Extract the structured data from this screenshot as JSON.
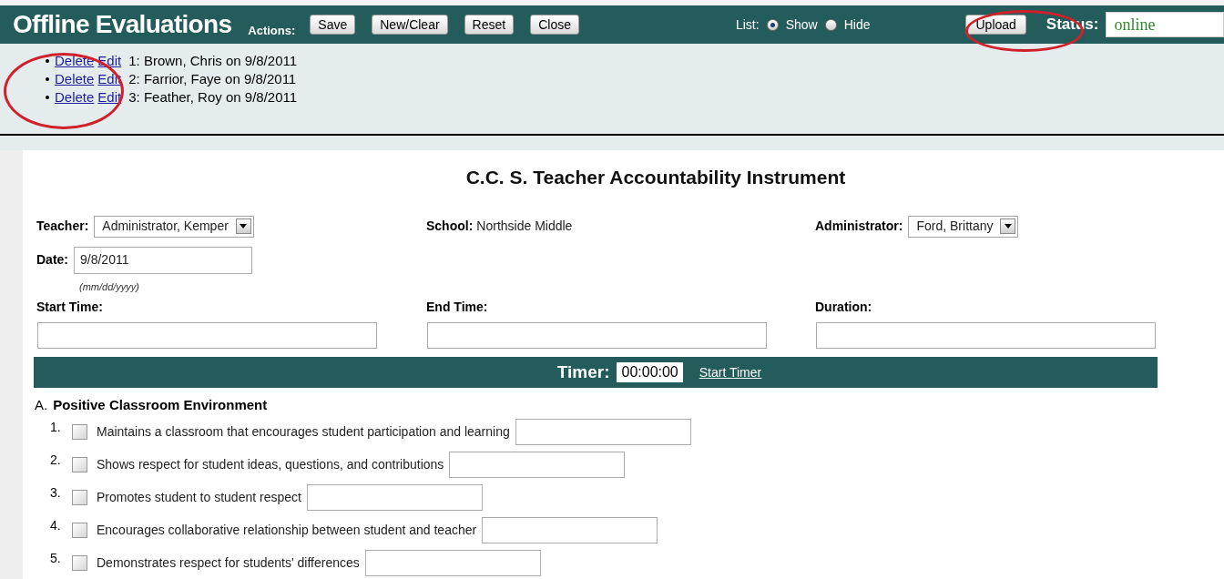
{
  "header": {
    "title": "Offline Evaluations",
    "actions_label": "Actions:",
    "buttons": [
      "Save",
      "New/Clear",
      "Reset",
      "Close"
    ],
    "list_toggle": {
      "label": "List:",
      "options": [
        {
          "label": "Show",
          "selected": true
        },
        {
          "label": "Hide",
          "selected": false
        }
      ]
    },
    "upload_button": "Upload",
    "status_label": "Status:",
    "status_value": "online"
  },
  "saved_list": [
    {
      "delete": "Delete",
      "edit": "Edit",
      "text": "1: Brown, Chris on 9/8/2011"
    },
    {
      "delete": "Delete",
      "edit": "Edit",
      "text": "2: Farrior, Faye on 9/8/2011"
    },
    {
      "delete": "Delete",
      "edit": "Edit",
      "text": "3: Feather, Roy on 9/8/2011"
    }
  ],
  "form": {
    "title": "C.C. S. Teacher Accountability Instrument",
    "teacher": {
      "label": "Teacher:",
      "value": "Administrator, Kemper"
    },
    "school": {
      "label": "School:",
      "value": "Northside Middle"
    },
    "administrator": {
      "label": "Administrator:",
      "value": "Ford, Brittany"
    },
    "date": {
      "label": "Date:",
      "value": "9/8/2011",
      "hint": "(mm/dd/yyyy)"
    },
    "times": [
      {
        "label": "Start Time:"
      },
      {
        "label": "End Time:"
      },
      {
        "label": "Duration:"
      }
    ],
    "timer": {
      "label": "Timer:",
      "value": "00:00:00",
      "link": "Start Timer"
    },
    "section": {
      "letter": "A.",
      "title": "Positive Classroom Environment",
      "items": [
        {
          "number": "1.",
          "text": "Maintains a classroom that encourages student participation and learning",
          "checked": false
        },
        {
          "number": "2.",
          "text": "Shows respect for student ideas, questions, and contributions",
          "checked": false
        },
        {
          "number": "3.",
          "text": "Promotes student to student respect",
          "checked": false
        },
        {
          "number": "4.",
          "text": "Encourages collaborative relationship between student and teacher",
          "checked": false
        },
        {
          "number": "5.",
          "text": "Demonstrates respect for students' differences",
          "checked": false
        }
      ]
    }
  }
}
